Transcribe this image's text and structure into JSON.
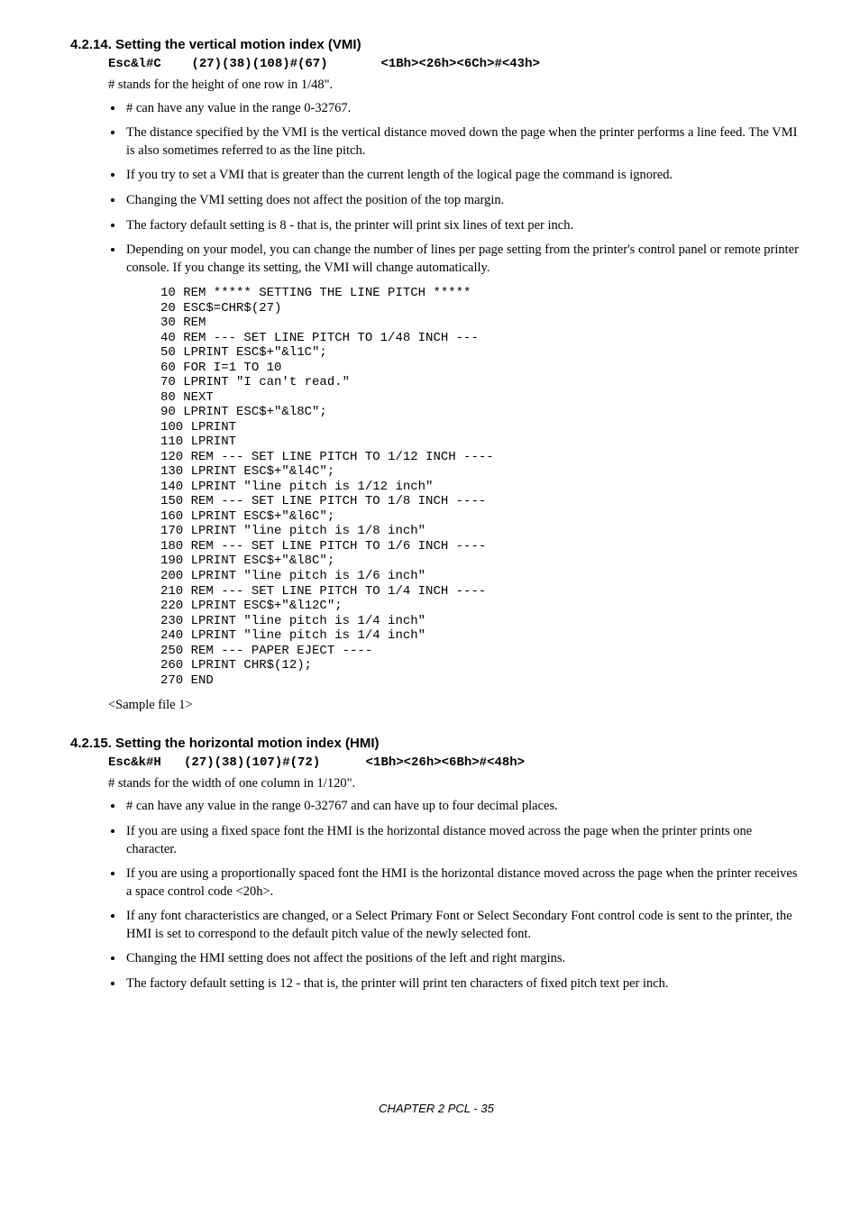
{
  "s1": {
    "heading": "4.2.14.  Setting the vertical motion index (VMI)",
    "esc_line": "Esc&l#C    (27)(38)(108)#(67)       <1Bh><26h><6Ch>#<43h>",
    "intro": "# stands for the height of one row in 1/48\".",
    "bullets": [
      "# can have any value in the range 0-32767.",
      "The distance specified by the VMI is the vertical distance moved down the page when the printer performs a line feed. The VMI is also sometimes referred to as the line pitch.",
      "If you try to set a VMI that is greater than the current length of the logical page the command is ignored.",
      "Changing the VMI setting does not affect the position of the top margin.",
      "The factory default setting is 8 - that is, the printer will print six lines of text per inch.",
      "Depending on your model,  you can change the number of lines per page setting from the printer's control panel or remote printer console.  If you change its setting, the VMI will change automatically."
    ],
    "code": "10 REM ***** SETTING THE LINE PITCH *****\n20 ESC$=CHR$(27)\n30 REM\n40 REM --- SET LINE PITCH TO 1/48 INCH ---\n50 LPRINT ESC$+\"&l1C\";\n60 FOR I=1 TO 10\n70 LPRINT \"I can't read.\"\n80 NEXT\n90 LPRINT ESC$+\"&l8C\";\n100 LPRINT\n110 LPRINT\n120 REM --- SET LINE PITCH TO 1/12 INCH ----\n130 LPRINT ESC$+\"&l4C\";\n140 LPRINT \"line pitch is 1/12 inch\"\n150 REM --- SET LINE PITCH TO 1/8 INCH ----\n160 LPRINT ESC$+\"&l6C\";\n170 LPRINT \"line pitch is 1/8 inch\"\n180 REM --- SET LINE PITCH TO 1/6 INCH ----\n190 LPRINT ESC$+\"&l8C\";\n200 LPRINT \"line pitch is 1/6 inch\"\n210 REM --- SET LINE PITCH TO 1/4 INCH ----\n220 LPRINT ESC$+\"&l12C\";\n230 LPRINT \"line pitch is 1/4 inch\"\n240 LPRINT \"line pitch is 1/4 inch\"\n250 REM --- PAPER EJECT ----\n260 LPRINT CHR$(12);\n270 END",
    "sample_note": "<Sample file 1>"
  },
  "s2": {
    "heading": "4.2.15.  Setting the horizontal motion index (HMI)",
    "esc_line": "Esc&k#H   (27)(38)(107)#(72)      <1Bh><26h><6Bh>#<48h>",
    "intro": "# stands for the width of one column in 1/120\".",
    "bullets": [
      "# can have any value in the range 0-32767 and can have up to four decimal places.",
      "If you are using a fixed space font the HMI is the horizontal distance moved across the page when the printer prints one character.",
      "If you are using a proportionally spaced font the HMI is the horizontal distance moved across the page when the printer receives a space control code <20h>.",
      "If any font characteristics are changed, or a Select Primary Font or Select Secondary Font control code is sent to the printer, the HMI is set to correspond to the default pitch value of the newly selected font.",
      "Changing the HMI setting does not affect the positions of the left and right margins.",
      "The factory default setting is 12 - that is, the printer will print ten characters of fixed pitch text per inch."
    ]
  },
  "footer": "CHAPTER 2 PCL - 35"
}
